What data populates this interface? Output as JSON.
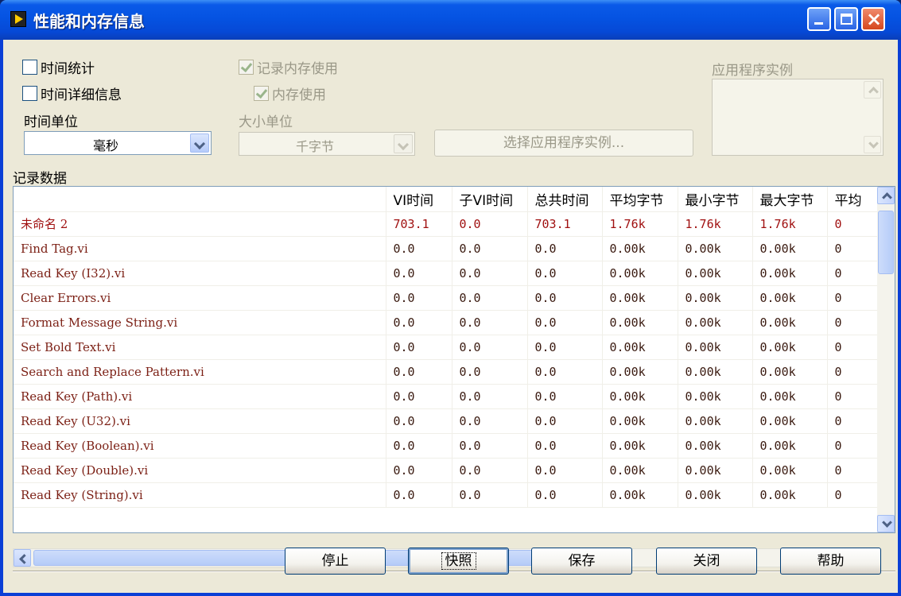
{
  "window": {
    "title": "性能和内存信息"
  },
  "options": {
    "timing_stats": {
      "label": "时间统计",
      "checked": false,
      "enabled": true
    },
    "timing_details": {
      "label": "时间详细信息",
      "checked": false,
      "enabled": true
    },
    "profile_memory": {
      "label": "记录内存使用",
      "checked": true,
      "enabled": false
    },
    "memory_usage": {
      "label": "内存使用",
      "checked": true,
      "enabled": false
    },
    "timing_unit": {
      "label": "时间单位",
      "value": "毫秒"
    },
    "size_unit": {
      "label": "大小单位",
      "value": "千字节"
    },
    "select_app_button": "选择应用程序实例...",
    "app_instances_label": "应用程序实例"
  },
  "data_section": {
    "label": "记录数据"
  },
  "table": {
    "columns": [
      "",
      "VI时间",
      "子VI时间",
      "总共时间",
      "平均字节",
      "最小字节",
      "最大字节",
      "平均"
    ],
    "rows": [
      [
        "未命名 2",
        "703.1",
        "0.0",
        "703.1",
        "1.76k",
        "1.76k",
        "1.76k",
        "0"
      ],
      [
        "Find Tag.vi",
        "0.0",
        "0.0",
        "0.0",
        "0.00k",
        "0.00k",
        "0.00k",
        "0"
      ],
      [
        "Read Key (I32).vi",
        "0.0",
        "0.0",
        "0.0",
        "0.00k",
        "0.00k",
        "0.00k",
        "0"
      ],
      [
        "Clear Errors.vi",
        "0.0",
        "0.0",
        "0.0",
        "0.00k",
        "0.00k",
        "0.00k",
        "0"
      ],
      [
        "Format Message String.vi",
        "0.0",
        "0.0",
        "0.0",
        "0.00k",
        "0.00k",
        "0.00k",
        "0"
      ],
      [
        "Set Bold Text.vi",
        "0.0",
        "0.0",
        "0.0",
        "0.00k",
        "0.00k",
        "0.00k",
        "0"
      ],
      [
        "Search and Replace Pattern.vi",
        "0.0",
        "0.0",
        "0.0",
        "0.00k",
        "0.00k",
        "0.00k",
        "0"
      ],
      [
        "Read Key (Path).vi",
        "0.0",
        "0.0",
        "0.0",
        "0.00k",
        "0.00k",
        "0.00k",
        "0"
      ],
      [
        "Read Key (U32).vi",
        "0.0",
        "0.0",
        "0.0",
        "0.00k",
        "0.00k",
        "0.00k",
        "0"
      ],
      [
        "Read Key (Boolean).vi",
        "0.0",
        "0.0",
        "0.0",
        "0.00k",
        "0.00k",
        "0.00k",
        "0"
      ],
      [
        "Read Key (Double).vi",
        "0.0",
        "0.0",
        "0.0",
        "0.00k",
        "0.00k",
        "0.00k",
        "0"
      ],
      [
        "Read Key (String).vi",
        "0.0",
        "0.0",
        "0.0",
        "0.00k",
        "0.00k",
        "0.00k",
        "0"
      ]
    ]
  },
  "buttons": {
    "stop": "停止",
    "snapshot": "快照",
    "save": "保存",
    "close": "关闭",
    "help": "帮助"
  },
  "icons": {
    "app": "labview-run-icon",
    "minimize": "minimize-icon",
    "maximize": "maximize-icon",
    "close": "close-icon"
  },
  "colors": {
    "titlebar": "#0553e2",
    "window_bg": "#ece9d8",
    "vi_name_text": "#7b1f14",
    "first_row_text": "#a01010"
  }
}
